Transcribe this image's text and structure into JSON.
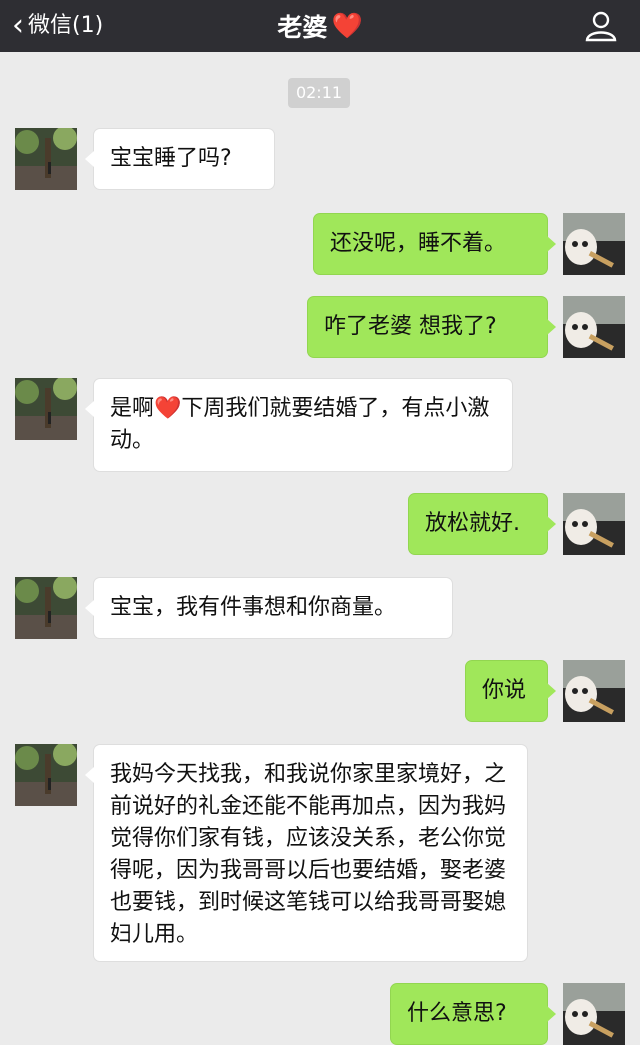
{
  "header": {
    "back_label": "微信(1)",
    "title": "老婆",
    "title_emoji": "❤️"
  },
  "timestamp": "02:11",
  "messages": [
    {
      "side": "left",
      "text": "宝宝睡了吗?"
    },
    {
      "side": "right",
      "text": "还没呢，睡不着。"
    },
    {
      "side": "right",
      "text": "咋了老婆 想我了?"
    },
    {
      "side": "left",
      "text_before": "是啊",
      "emoji": "❤️",
      "text_after": "下周我们就要结婚了，有点小激动。"
    },
    {
      "side": "right",
      "text": "放松就好."
    },
    {
      "side": "left",
      "text": "宝宝，我有件事想和你商量。"
    },
    {
      "side": "right",
      "text": "你说"
    },
    {
      "side": "left",
      "text": "我妈今天找我，和我说你家里家境好，之前说好的礼金还能不能再加点，因为我妈觉得你们家有钱，应该没关系，老公你觉得呢，因为我哥哥以后也要结婚，娶老婆也要钱，到时候这笔钱可以给我哥哥娶媳妇儿用。"
    },
    {
      "side": "right",
      "text": "什么意思?"
    }
  ],
  "colors": {
    "header_bg": "#2e2e33",
    "chat_bg": "#ebebeb",
    "bubble_left": "#ffffff",
    "bubble_right": "#a0e75a"
  }
}
